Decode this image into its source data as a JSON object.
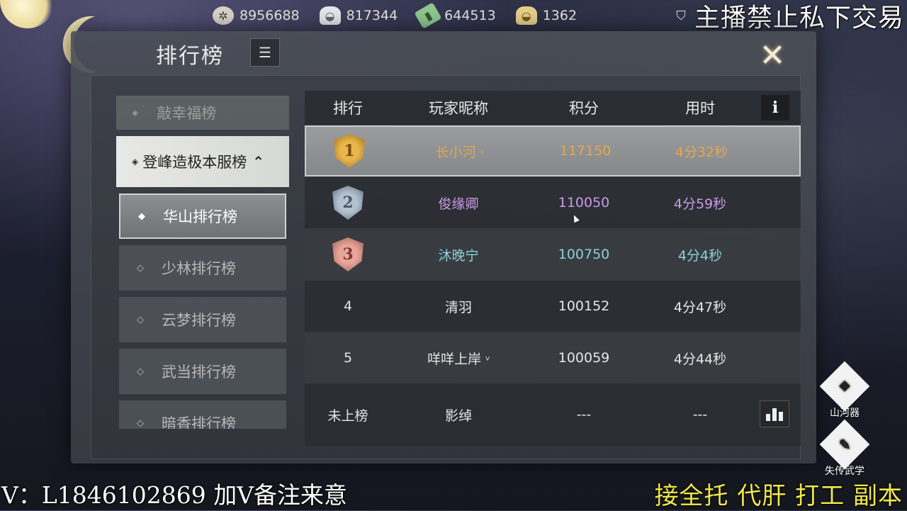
{
  "currencies": [
    {
      "icon": "film-reel-icon",
      "value": "8956688"
    },
    {
      "icon": "silver-ingot-icon",
      "value": "817344"
    },
    {
      "icon": "jade-icon",
      "value": "644513"
    },
    {
      "icon": "gold-ingot-icon",
      "value": "1362"
    }
  ],
  "overlay": {
    "top_notice": "主播禁止私下交易",
    "bottom_left": "V：L1846102869 加V备注来意",
    "bottom_right": "接全托 代肝 打工 副本"
  },
  "panel": {
    "title": "排行榜",
    "title_icon": "list-box-icon",
    "close_icon": "close-icon"
  },
  "menu": {
    "faded_item": "敲幸福榜",
    "open_category": "登峰造极本服榜",
    "sub_items": [
      "华山排行榜",
      "少林排行榜",
      "云梦排行榜",
      "武当排行榜",
      "暗香排行榜"
    ],
    "active_index": 0
  },
  "table": {
    "headers": {
      "rank": "排行",
      "name": "玩家昵称",
      "score": "积分",
      "time": "用时"
    },
    "rows": [
      {
        "rank": "1",
        "name": "长小河",
        "score": "117150",
        "time": "4分32秒",
        "color": "#e8a64a"
      },
      {
        "rank": "2",
        "name": "俊缘卿",
        "score": "110050",
        "time": "4分59秒",
        "color": "#c99ae8"
      },
      {
        "rank": "3",
        "name": "沐晚宁",
        "score": "100750",
        "time": "4分4秒",
        "color": "#8ccfd8"
      },
      {
        "rank": "4",
        "name": "清羽",
        "score": "100152",
        "time": "4分47秒",
        "color": "#e6e6e6"
      },
      {
        "rank": "5",
        "name": "咩咩上岸",
        "score": "100059",
        "time": "4分44秒",
        "color": "#e6e6e6"
      }
    ],
    "self_row": {
      "rank": "未上榜",
      "name": "影绰",
      "score": "---",
      "time": "---"
    }
  },
  "side_buttons": [
    {
      "label": "山河器",
      "icon": "mountain-river-icon"
    },
    {
      "label": "失传武学",
      "icon": "lost-martial-arts-icon"
    }
  ]
}
